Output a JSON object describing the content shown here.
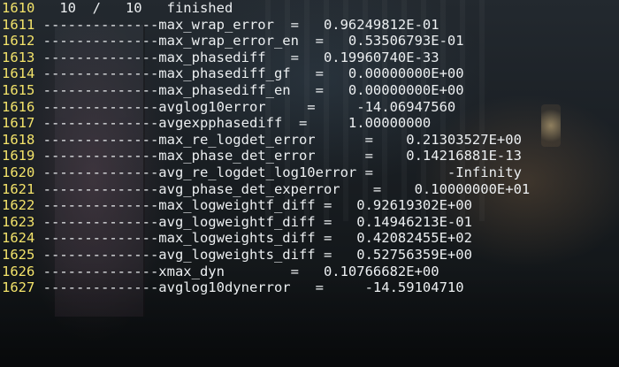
{
  "terminal": {
    "lines": [
      {
        "no": "1610",
        "text": "   10  /   10   finished"
      },
      {
        "no": "1611",
        "text": " --------------max_wrap_error  =   0.96249812E-01"
      },
      {
        "no": "1612",
        "text": " --------------max_wrap_error_en  =   0.53506793E-01"
      },
      {
        "no": "1613",
        "text": " --------------max_phasediff   =   0.19960740E-33"
      },
      {
        "no": "1614",
        "text": " --------------max_phasediff_gf   =   0.00000000E+00"
      },
      {
        "no": "1615",
        "text": " --------------max_phasediff_en   =   0.00000000E+00"
      },
      {
        "no": "1616",
        "text": " --------------avglog10error     =     -14.06947560"
      },
      {
        "no": "1617",
        "text": " --------------avgexpphasediff  =     1.00000000"
      },
      {
        "no": "1618",
        "text": " --------------max_re_logdet_error      =    0.21303527E+00"
      },
      {
        "no": "1619",
        "text": " --------------max_phase_det_error      =    0.14216881E-13"
      },
      {
        "no": "1620",
        "text": " --------------avg_re_logdet_log10error =         -Infinity"
      },
      {
        "no": "1621",
        "text": " --------------avg_phase_det_experror    =    0.10000000E+01"
      },
      {
        "no": "1622",
        "text": " --------------max_logweightf_diff =   0.92619302E+00"
      },
      {
        "no": "1623",
        "text": " --------------avg_logweightf_diff =   0.14946213E-01"
      },
      {
        "no": "1624",
        "text": " --------------max_logweights_diff =   0.42082455E+02"
      },
      {
        "no": "1625",
        "text": " --------------avg_logweights_diff =   0.52756359E+00"
      },
      {
        "no": "1626",
        "text": " --------------xmax_dyn        =   0.10766682E+00"
      },
      {
        "no": "1627",
        "text": " --------------avglog10dynerror   =     -14.59104710"
      }
    ]
  }
}
